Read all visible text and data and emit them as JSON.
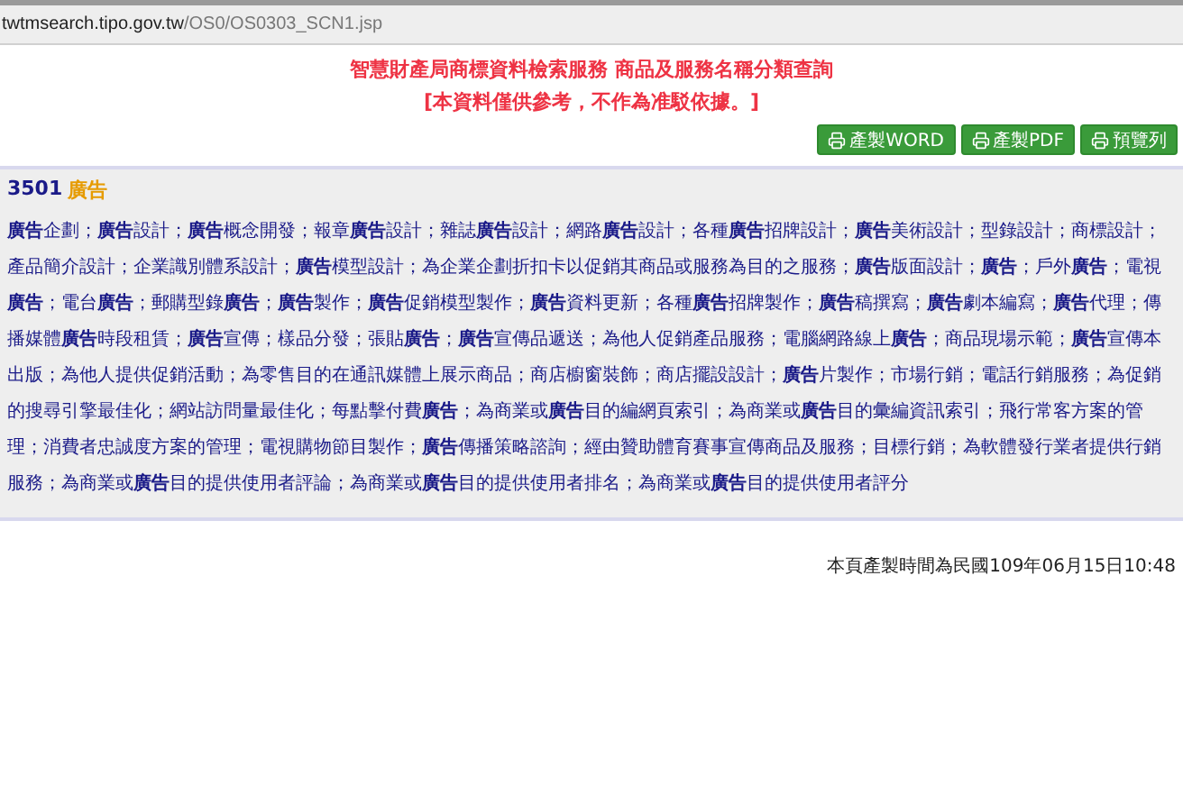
{
  "address_bar": {
    "host": "twtmsearch.tipo.gov.tw",
    "path": "/OS0/OS0303_SCN1.jsp"
  },
  "header": {
    "title": "智慧財產局商標資料檢索服務 商品及服務名稱分類查詢",
    "notice": "[本資料僅供參考，不作為准駁依據。]"
  },
  "buttons": [
    "產製WORD",
    "產製PDF",
    "預覽列"
  ],
  "group": {
    "code": "3501",
    "name": "廣告",
    "description": "**廣告**企劃；**廣告**設計；**廣告**概念開發；報章**廣告**設計；雜誌**廣告**設計；網路**廣告**設計；各種**廣告**招牌設計；**廣告**美術設計；型錄設計；商標設計；產品簡介設計；企業識別體系設計；**廣告**模型設計；為企業企劃折扣卡以促銷其商品或服務為目的之服務；**廣告**版面設計；**廣告**；戶外**廣告**；電視**廣告**；電台**廣告**；郵購型錄**廣告**；**廣告**製作；**廣告**促銷模型製作；**廣告**資料更新；各種**廣告**招牌製作；**廣告**稿撰寫；**廣告**劇本編寫；**廣告**代理；傳播媒體**廣告**時段租賃；**廣告**宣傳；樣品分發；張貼**廣告**；**廣告**宣傳品遞送；為他人促銷產品服務；電腦網路線上**廣告**；商品現場示範；**廣告**宣傳本出版；為他人提供促銷活動；為零售目的在通訊媒體上展示商品；商店櫥窗裝飾；商店擺設設計；**廣告**片製作；市場行銷；電話行銷服務；為促銷的搜尋引擎最佳化；網站訪問量最佳化；每點擊付費**廣告**；為商業或**廣告**目的編網頁索引；為商業或**廣告**目的彙編資訊索引；飛行常客方案的管理；消費者忠誠度方案的管理；電視購物節目製作；**廣告**傳播策略諮詢；經由贊助體育賽事宣傳商品及服務；目標行銷；為軟體發行業者提供行銷服務；為商業或**廣告**目的提供使用者評論；為商業或**廣告**目的提供使用者排名；為商業或**廣告**目的提供使用者評分"
  },
  "footer": "本頁產製時間為民國109年06月15日10:48"
}
